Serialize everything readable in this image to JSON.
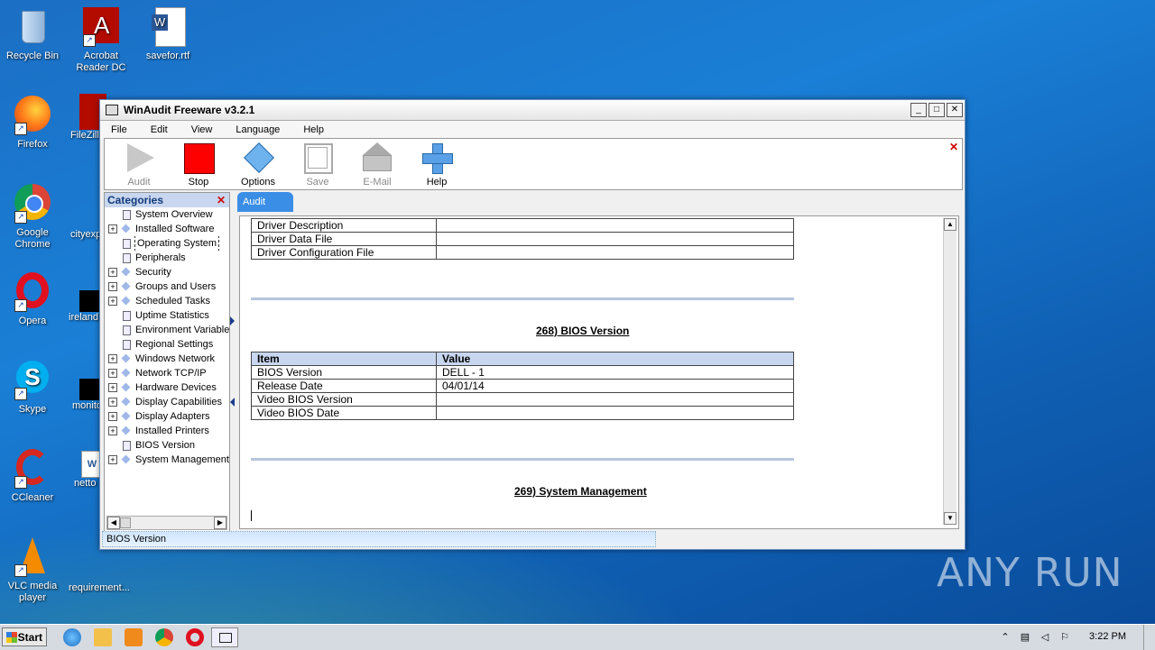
{
  "desktop": {
    "icons": [
      {
        "label": "Recycle Bin"
      },
      {
        "label": "Acrobat Reader DC"
      },
      {
        "label": "savefor.rtf"
      },
      {
        "label": "Firefox"
      },
      {
        "label": "FileZilla"
      },
      {
        "label": "Google Chrome"
      },
      {
        "label": "cityexp"
      },
      {
        "label": "Opera"
      },
      {
        "label": "ireland"
      },
      {
        "label": "Skype"
      },
      {
        "label": "monito"
      },
      {
        "label": "CCleaner"
      },
      {
        "label": "netto"
      },
      {
        "label": "VLC media player"
      },
      {
        "label": "requirement..."
      }
    ],
    "watermark": "ANY RUN"
  },
  "window": {
    "title": "WinAudit Freeware v3.2.1",
    "menu": [
      "File",
      "Edit",
      "View",
      "Language",
      "Help"
    ],
    "toolbar": [
      {
        "label": "Audit",
        "enabled": false
      },
      {
        "label": "Stop",
        "enabled": true
      },
      {
        "label": "Options",
        "enabled": true
      },
      {
        "label": "Save",
        "enabled": false
      },
      {
        "label": "E-Mail",
        "enabled": false
      },
      {
        "label": "Help",
        "enabled": true
      }
    ],
    "categories": {
      "header": "Categories",
      "items": [
        {
          "label": "System Overview",
          "expandable": false,
          "icon": "doc"
        },
        {
          "label": "Installed Software",
          "expandable": true,
          "icon": "diamond"
        },
        {
          "label": "Operating System",
          "expandable": false,
          "icon": "doc",
          "selected": true
        },
        {
          "label": "Peripherals",
          "expandable": false,
          "icon": "doc"
        },
        {
          "label": "Security",
          "expandable": true,
          "icon": "diamond"
        },
        {
          "label": "Groups and Users",
          "expandable": true,
          "icon": "diamond"
        },
        {
          "label": "Scheduled Tasks",
          "expandable": true,
          "icon": "diamond"
        },
        {
          "label": "Uptime Statistics",
          "expandable": false,
          "icon": "doc"
        },
        {
          "label": "Environment Variables",
          "expandable": false,
          "icon": "doc"
        },
        {
          "label": "Regional Settings",
          "expandable": false,
          "icon": "doc"
        },
        {
          "label": "Windows Network",
          "expandable": true,
          "icon": "diamond"
        },
        {
          "label": "Network TCP/IP",
          "expandable": true,
          "icon": "diamond"
        },
        {
          "label": "Hardware Devices",
          "expandable": true,
          "icon": "diamond"
        },
        {
          "label": "Display Capabilities",
          "expandable": true,
          "icon": "diamond"
        },
        {
          "label": "Display Adapters",
          "expandable": true,
          "icon": "diamond"
        },
        {
          "label": "Installed Printers",
          "expandable": true,
          "icon": "diamond"
        },
        {
          "label": "BIOS Version",
          "expandable": false,
          "icon": "doc"
        },
        {
          "label": "System Management",
          "expandable": true,
          "icon": "diamond"
        }
      ]
    },
    "tab": "Audit",
    "report": {
      "prev_table_rows": [
        [
          "Driver Description",
          ""
        ],
        [
          "Driver Data File",
          ""
        ],
        [
          "Driver Configuration File",
          ""
        ]
      ],
      "section_268_title": "268) BIOS Version",
      "bios_table": {
        "headers": [
          "Item",
          "Value"
        ],
        "rows": [
          [
            "BIOS Version",
            "DELL  - 1"
          ],
          [
            "Release Date",
            "04/01/14"
          ],
          [
            "Video BIOS Version",
            ""
          ],
          [
            "Video BIOS Date",
            ""
          ]
        ]
      },
      "section_269_title": "269) System Management"
    },
    "status": "BIOS Version"
  },
  "taskbar": {
    "start": "Start",
    "clock": "3:22 PM"
  }
}
